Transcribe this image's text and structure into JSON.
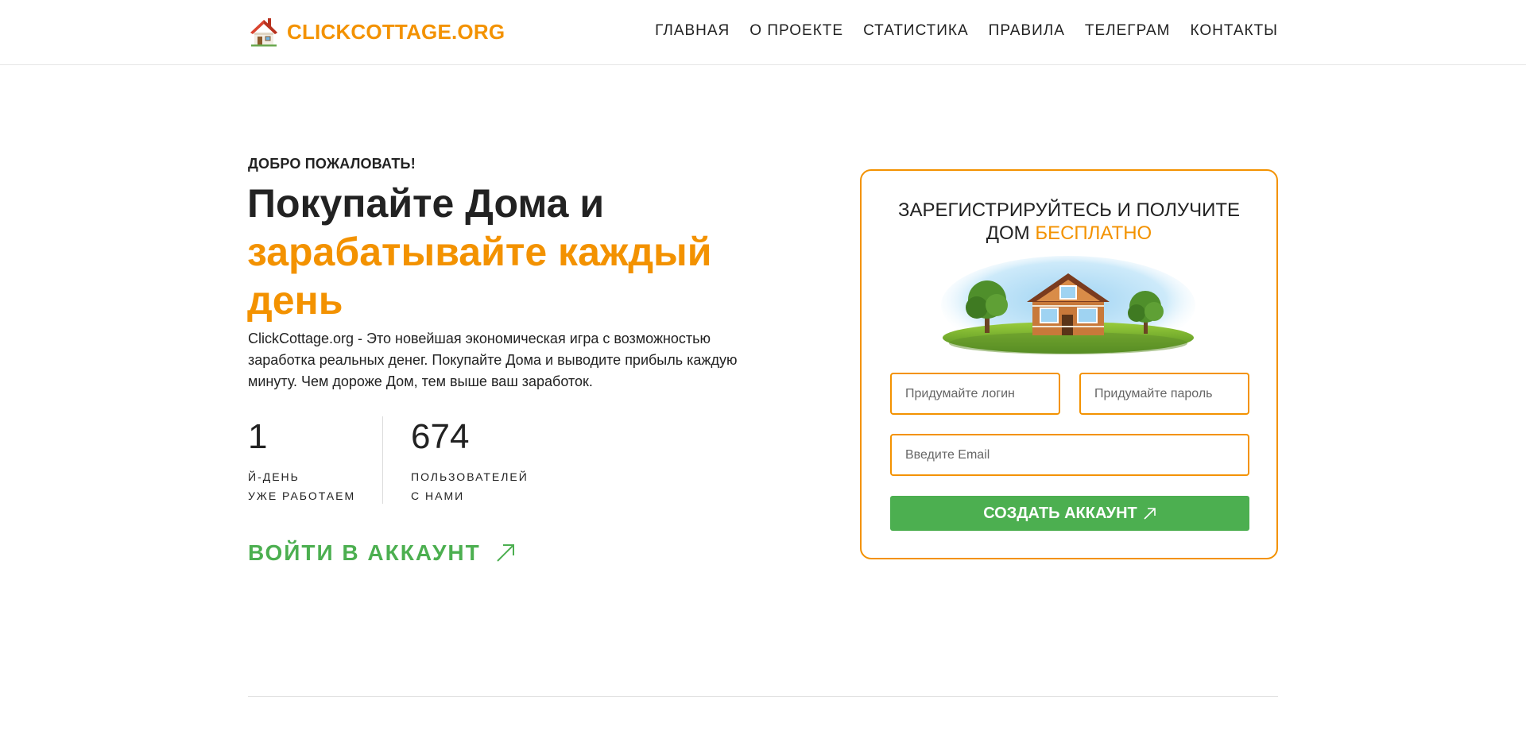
{
  "header": {
    "logo_text": "CLICKCOTTAGE.ORG",
    "logo_icon": "house-icon",
    "nav": [
      {
        "label": "ГЛАВНАЯ"
      },
      {
        "label": "О ПРОЕКТЕ"
      },
      {
        "label": "СТАТИСТИКА"
      },
      {
        "label": "ПРАВИЛА"
      },
      {
        "label": "ТЕЛЕГРАМ"
      },
      {
        "label": "КОНТАКТЫ"
      }
    ]
  },
  "hero": {
    "welcome": "ДОБРО ПОЖАЛОВАТЬ!",
    "headline_plain": "Покупайте Дома и",
    "headline_accent": "зарабатывайте каждый день",
    "description": "ClickCottage.org - Это новейшая экономическая игра с возможностью заработка реальных денег. Покупайте Дома и выводите прибыль каждую минуту. Чем дороже Дом, тем выше ваш заработок.",
    "stats": [
      {
        "value": "1",
        "label_line1": "Й-ДЕНЬ",
        "label_line2": "УЖЕ РАБОТАЕМ"
      },
      {
        "value": "674",
        "label_line1": "ПОЛЬЗОВАТЕЛЕЙ",
        "label_line2": "С НАМИ"
      }
    ],
    "login_link": "ВОЙТИ В АККАУНТ",
    "login_icon": "arrow-up-right-icon"
  },
  "register": {
    "title_plain": "ЗАРЕГИСТРИРУЙТЕСЬ И ПОЛУЧИТЕ ДОМ",
    "title_accent": "БЕСПЛАТНО",
    "image": "cottage-on-grass-island",
    "login_placeholder": "Придумайте логин",
    "password_placeholder": "Придумайте пароль",
    "email_placeholder": "Введите Email",
    "submit_label": "СОЗДАТЬ АККАУНТ",
    "submit_icon": "arrow-up-right-icon"
  },
  "colors": {
    "accent": "#f39200",
    "green": "#4caf50",
    "text": "#222222"
  }
}
